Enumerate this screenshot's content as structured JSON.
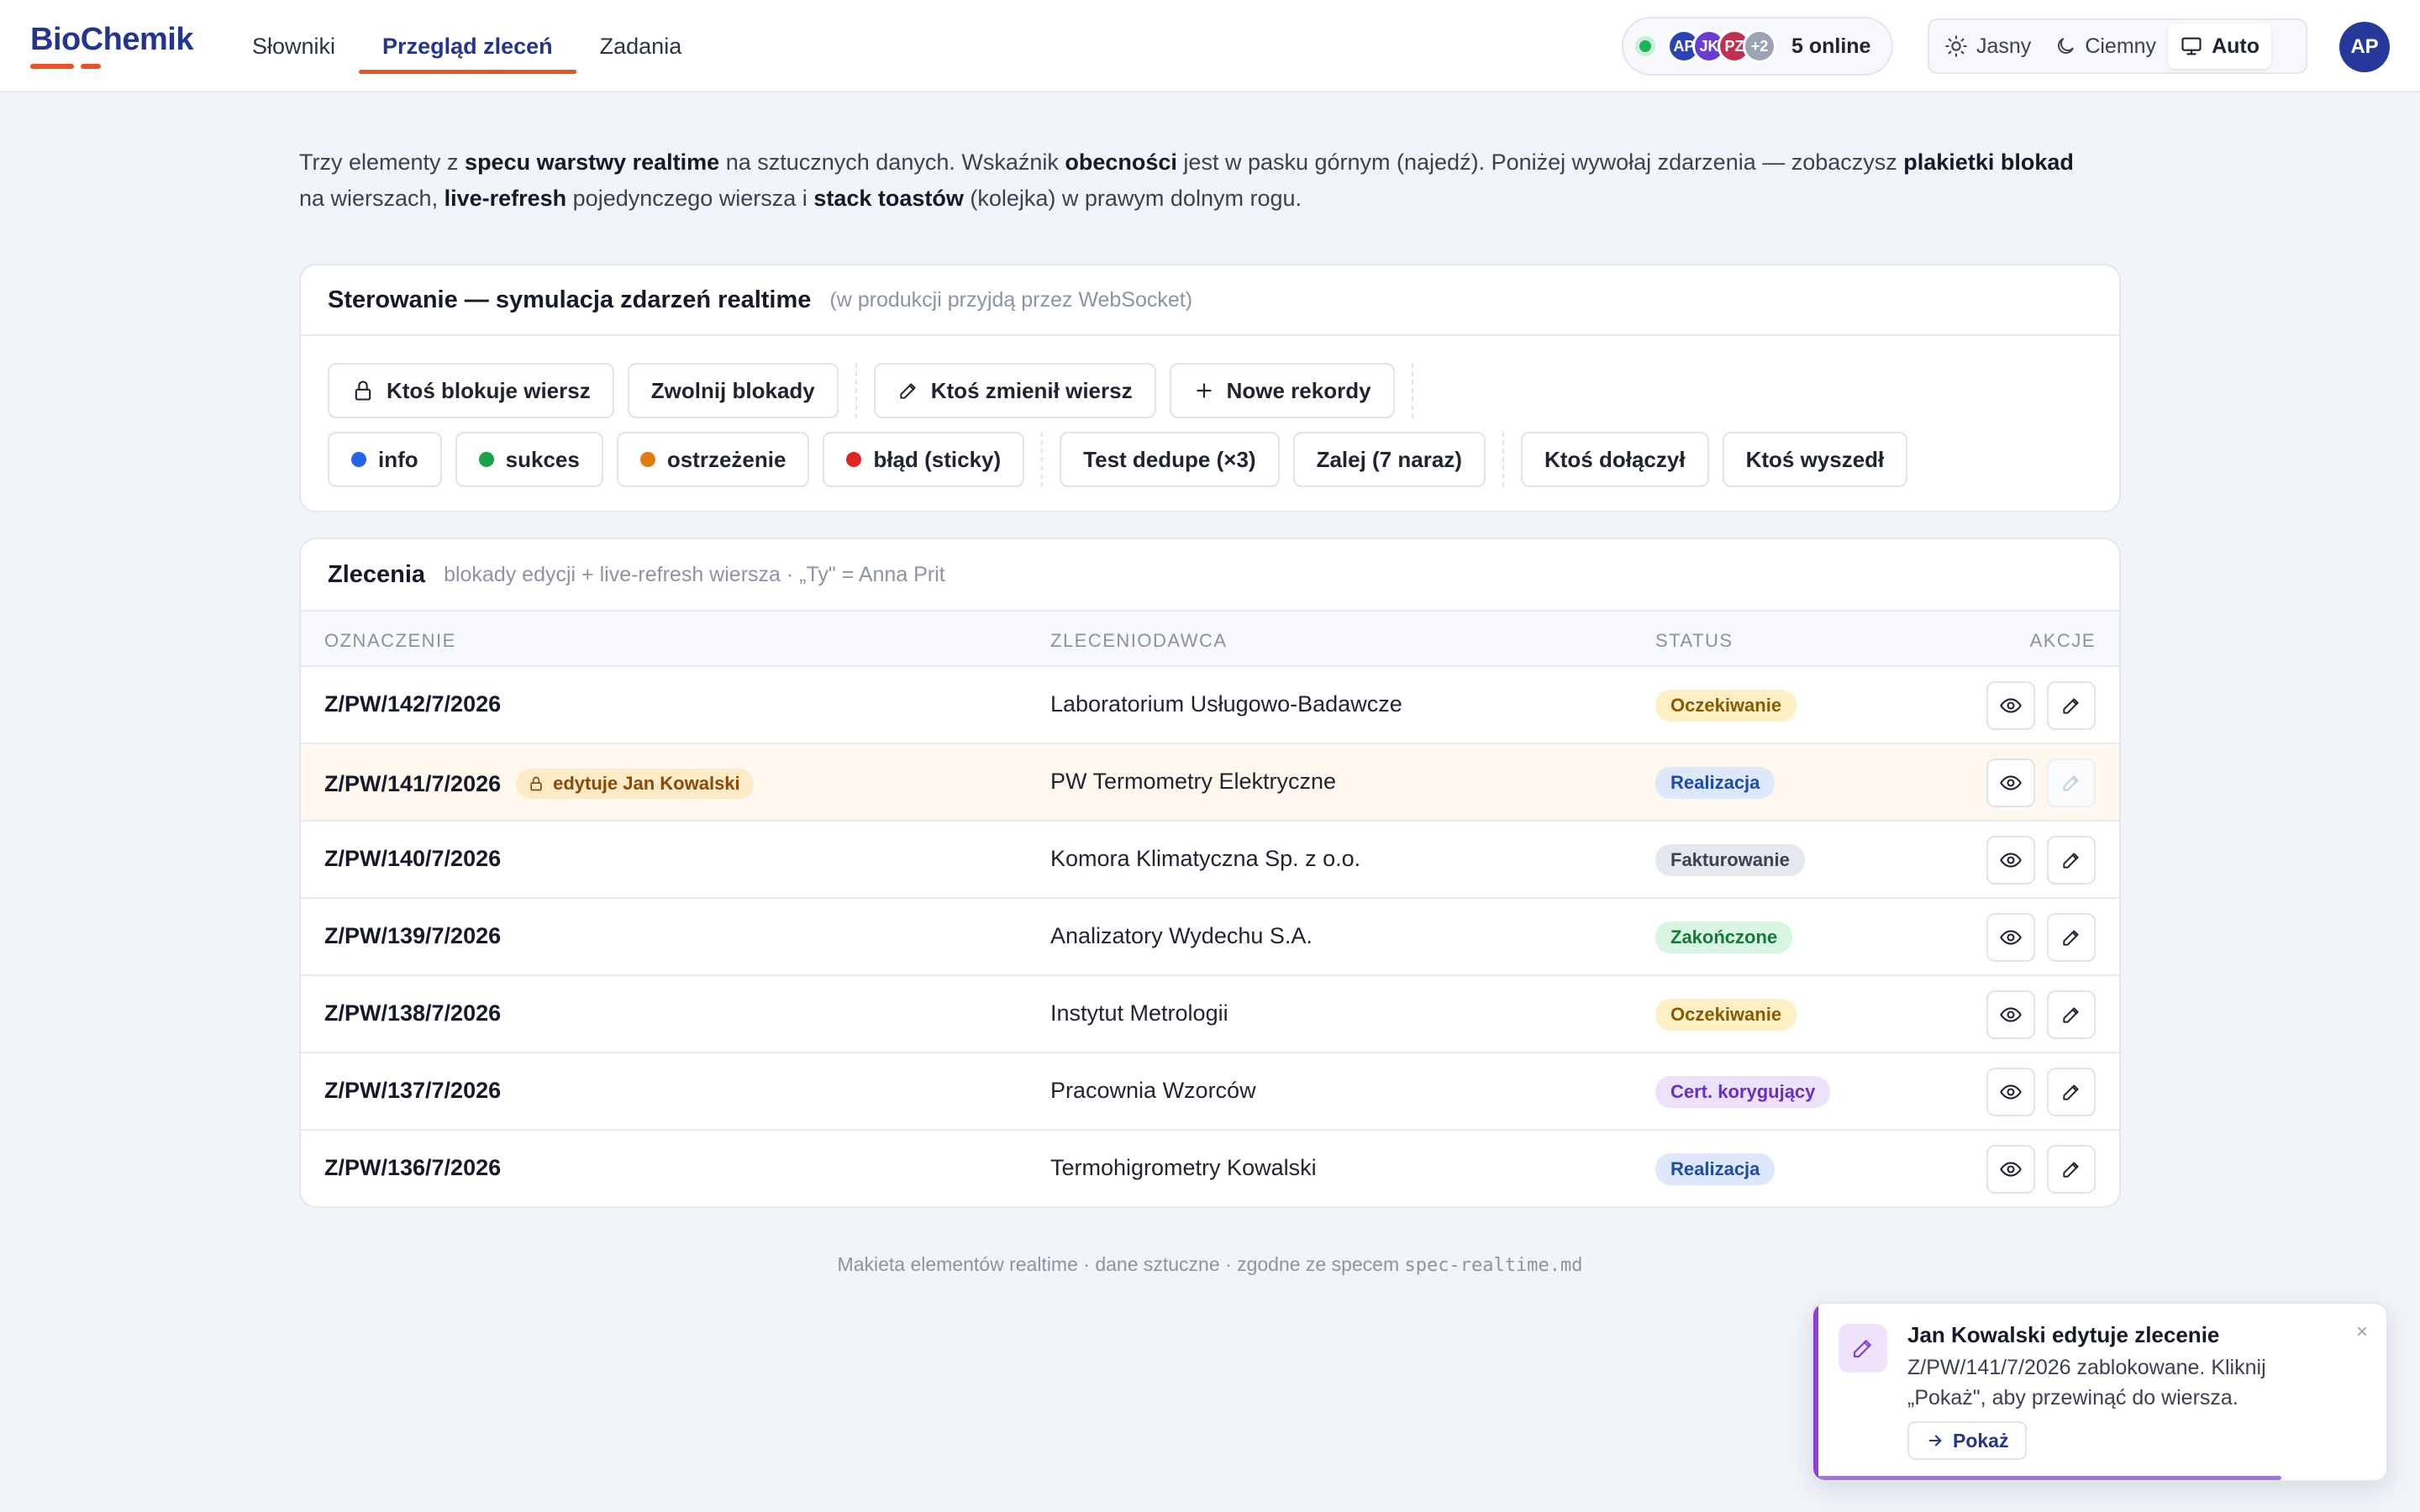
{
  "app": {
    "name": "BioChemik"
  },
  "nav": [
    {
      "label": "Słowniki"
    },
    {
      "label": "Przegląd zleceń",
      "active": true
    },
    {
      "label": "Zadania"
    }
  ],
  "presence": {
    "avatars": [
      {
        "initials": "AP",
        "color": "#2c43b5"
      },
      {
        "initials": "JK",
        "color": "#6c3bd1"
      },
      {
        "initials": "PZ",
        "color": "#c2304f"
      },
      {
        "initials": "+2",
        "color": "#9ba3b4"
      }
    ],
    "label": "5 online"
  },
  "theme": {
    "light": "Jasny",
    "dark": "Ciemny",
    "auto": "Auto",
    "selected": "Auto"
  },
  "user": {
    "initials": "AP"
  },
  "intro": {
    "p1": "Trzy elementy z ",
    "b1": "specu warstwy realtime",
    "p2": " na sztucznych danych. Wskaźnik ",
    "b2": "obecności",
    "p3": " jest w pasku górnym (najedź). Poniżej wywołaj zdarzenia — zobaczysz ",
    "b3": "plakietki blokad",
    "p4": " na wierszach, ",
    "b4": "live-refresh",
    "p5": " pojedynczego wiersza i ",
    "b5": "stack toastów",
    "p6": " (kolejka) w prawym dolnym rogu."
  },
  "controls": {
    "title": "Sterowanie — symulacja zdarzeń realtime",
    "subtitle": "(w produkcji przyjdą przez WebSocket)",
    "row1": {
      "lock": "Ktoś blokuje wiersz",
      "unlock": "Zwolnij blokady",
      "change": "Ktoś zmienił wiersz",
      "new": "Nowe rekordy"
    },
    "row2": {
      "info": "info",
      "success": "sukces",
      "warning": "ostrzeżenie",
      "error": "błąd (sticky)",
      "dedupe": "Test dedupe (×3)",
      "flood": "Zalej (7 naraz)",
      "joined": "Ktoś dołączył",
      "left": "Ktoś wyszedł"
    },
    "colors": {
      "info": "#2563eb",
      "success": "#16a34a",
      "warning": "#e07b12",
      "error": "#dc2626"
    }
  },
  "orders": {
    "title": "Zlecenia",
    "subtitle": "blokady edycji + live-refresh wiersza · „Ty\" = Anna Prit",
    "columns": {
      "id": "OZNACZENIE",
      "client": "ZLECENIODAWCA",
      "status": "STATUS",
      "actions": "AKCJE"
    },
    "rows": [
      {
        "id": "Z/PW/142/7/2026",
        "client": "Laboratorium Usługowo-Badawcze",
        "status": "Oczekiwanie",
        "lock": ""
      },
      {
        "id": "Z/PW/141/7/2026",
        "client": "PW Termometry Elektryczne",
        "status": "Realizacja",
        "lock": "edytuje Jan Kowalski"
      },
      {
        "id": "Z/PW/140/7/2026",
        "client": "Komora Klimatyczna Sp. z o.o.",
        "status": "Fakturowanie",
        "lock": ""
      },
      {
        "id": "Z/PW/139/7/2026",
        "client": "Analizatory Wydechu S.A.",
        "status": "Zakończone",
        "lock": ""
      },
      {
        "id": "Z/PW/138/7/2026",
        "client": "Instytut Metrologii",
        "status": "Oczekiwanie",
        "lock": ""
      },
      {
        "id": "Z/PW/137/7/2026",
        "client": "Pracownia Wzorców",
        "status": "Cert. korygujący",
        "lock": ""
      },
      {
        "id": "Z/PW/136/7/2026",
        "client": "Termohigrometry Kowalski",
        "status": "Realizacja",
        "lock": ""
      }
    ],
    "status_colors": {
      "Oczekiwanie": {
        "bg": "#fdf0c4",
        "fg": "#8a5a00"
      },
      "Realizacja": {
        "bg": "#dde8fc",
        "fg": "#1f4aa8"
      },
      "Fakturowanie": {
        "bg": "#e5e8ef",
        "fg": "#3b4252"
      },
      "Zakończone": {
        "bg": "#d8f5e2",
        "fg": "#137a3c"
      },
      "Cert. korygujący": {
        "bg": "#ece2fb",
        "fg": "#6a2fc0"
      }
    }
  },
  "footer": {
    "text": "Makieta elementów realtime · dane sztuczne · zgodne ze specem ",
    "file": "spec-realtime.md"
  },
  "toast": {
    "title": "Jan Kowalski edytuje zlecenie",
    "body": "Z/PW/141/7/2026 zablokowane. Kliknij „Pokaż\", aby przewinąć do wiersza.",
    "action": "Pokaż",
    "close": "×",
    "progress": 0.81,
    "accent": "#8b3fd9"
  }
}
